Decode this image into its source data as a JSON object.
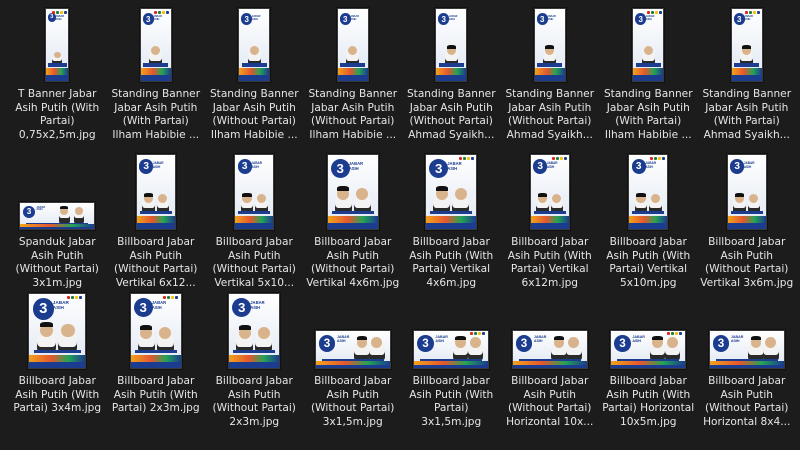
{
  "files": [
    {
      "name": "T Banner Jabar Asih Putih (With Partai) 0,75x2,5m.jpg",
      "shape": "tall-narrow",
      "party": true,
      "people": 1
    },
    {
      "name": "Standing Banner Jabar Asih Putih (With Partai) Ilham Habibie ...",
      "shape": "standing",
      "party": true,
      "people": 1
    },
    {
      "name": "Standing Banner Jabar Asih Putih (Without Partai) Ilham Habibie ...",
      "shape": "standing",
      "party": false,
      "people": 1
    },
    {
      "name": "Standing Banner Jabar Asih Putih (Without Partai) Ilham Habibie ...",
      "shape": "standing",
      "party": false,
      "people": 1
    },
    {
      "name": "Standing Banner Jabar Asih Putih (Without Partai) Ahmad Syaikh...",
      "shape": "standing",
      "party": false,
      "people": 1,
      "cap": true
    },
    {
      "name": "Standing Banner Jabar Asih Putih (Without Partai) Ahmad Syaikh...",
      "shape": "standing",
      "party": false,
      "people": 1,
      "cap": true
    },
    {
      "name": "Standing Banner Jabar Asih Putih (With Partai) Ilham Habibie ...",
      "shape": "standing",
      "party": true,
      "people": 1
    },
    {
      "name": "Standing Banner Jabar Asih Putih (With Partai) Ahmad Syaikh...",
      "shape": "standing",
      "party": true,
      "people": 1,
      "cap": true
    },
    {
      "name": "Spanduk Jabar Asih Putih (Without Partai) 3x1m.jpg",
      "shape": "wide-thin",
      "party": false,
      "people": 2
    },
    {
      "name": "Billboard Jabar Asih Putih (Without Partai) Vertikal 6x12...",
      "shape": "vert-6x12",
      "party": false,
      "people": 2
    },
    {
      "name": "Billboard Jabar Asih Putih (Without Partai) Vertikal 5x10...",
      "shape": "vert-5x10",
      "party": false,
      "people": 2
    },
    {
      "name": "Billboard Jabar Asih Putih (Without Partai) Vertikal 4x6m.jpg",
      "shape": "vert-4x6",
      "party": false,
      "people": 2
    },
    {
      "name": "Billboard Jabar Asih Putih (With Partai) Vertikal 4x6m.jpg",
      "shape": "vert-4x6",
      "party": true,
      "people": 2
    },
    {
      "name": "Billboard Jabar Asih Putih (With Partai) Vertikal 6x12m.jpg",
      "shape": "vert-6x12",
      "party": true,
      "people": 2
    },
    {
      "name": "Billboard Jabar Asih Putih (With Partai) Vertikal 5x10m.jpg",
      "shape": "vert-5x10",
      "party": true,
      "people": 2
    },
    {
      "name": "Billboard Jabar Asih Putih (Without Partai) Vertikal 3x6m.jpg",
      "shape": "vert-5x10",
      "party": false,
      "people": 2
    },
    {
      "name": "Billboard Jabar Asih Putih (With Partai) 3x4m.jpg",
      "shape": "v-3x4",
      "party": true,
      "people": 2
    },
    {
      "name": "Billboard Jabar Asih Putih (With Partai) 2x3m.jpg",
      "shape": "v-2x3",
      "party": true,
      "people": 2
    },
    {
      "name": "Billboard Jabar Asih Putih (Without Partai) 2x3m.jpg",
      "shape": "v-2x3",
      "party": false,
      "people": 2
    },
    {
      "name": "Billboard Jabar Asih Putih (Without Partai) 3x1,5m.jpg",
      "shape": "h-2x1",
      "party": false,
      "people": 2
    },
    {
      "name": "Billboard Jabar Asih Putih (With Partai) 3x1,5m.jpg",
      "shape": "h-2x1",
      "party": true,
      "people": 2
    },
    {
      "name": "Billboard Jabar Asih Putih (Without Partai) Horizontal 10x...",
      "shape": "h-2x1",
      "party": false,
      "people": 2
    },
    {
      "name": "Billboard Jabar Asih Putih (With Partai) Horizontal 10x5m.jpg",
      "shape": "h-2x1",
      "party": true,
      "people": 2
    },
    {
      "name": "Billboard Jabar Asih Putih (Without Partai) Horizontal 8x4...",
      "shape": "h-2x1",
      "party": false,
      "people": 2
    }
  ],
  "poster_text": {
    "big": "3",
    "sub": "JABAR ASIH"
  }
}
